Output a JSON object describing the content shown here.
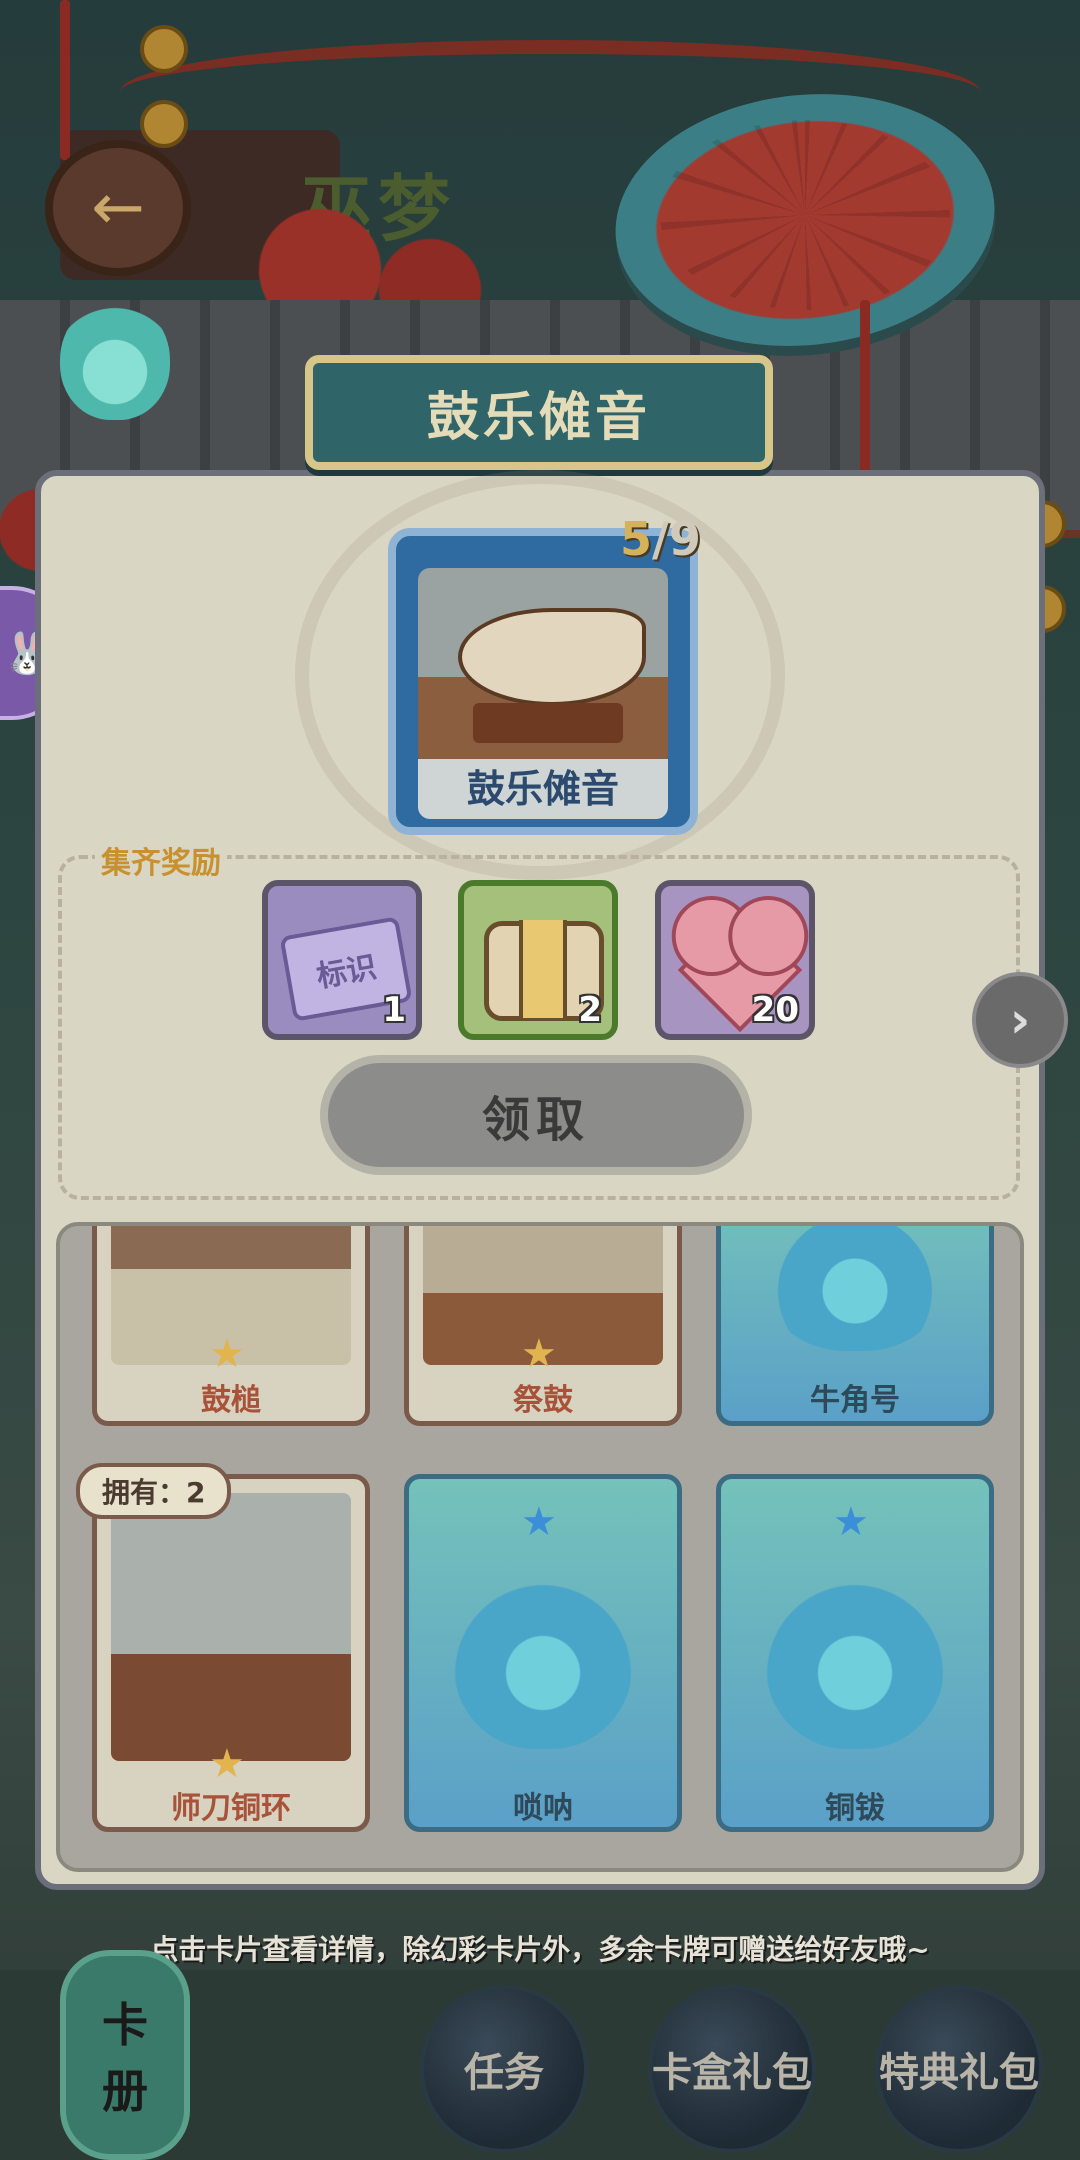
{
  "background": {
    "title_partial": "巫梦"
  },
  "collection": {
    "title": "鼓乐傩音",
    "progress_current": "5",
    "progress_total": "/9",
    "featured_card_label": "鼓乐傩音"
  },
  "rewards": {
    "label": "集齐奖励",
    "items": [
      {
        "icon": "tag-icon",
        "text": "标识",
        "quantity": "1"
      },
      {
        "icon": "chest-icon",
        "quantity": "2"
      },
      {
        "icon": "heart-icon",
        "quantity": "20"
      }
    ],
    "claim_label": "领取"
  },
  "cards": {
    "owned_badge": "拥有：2",
    "items": [
      {
        "name": "鼓槌",
        "state": "owned"
      },
      {
        "name": "祭鼓",
        "state": "owned"
      },
      {
        "name": "牛角号",
        "state": "locked"
      },
      {
        "name": "师刀铜环",
        "state": "owned"
      },
      {
        "name": "唢呐",
        "state": "locked"
      },
      {
        "name": "铜钹",
        "state": "locked"
      }
    ]
  },
  "hint": "点击卡片查看详情，除幻彩卡片外，多余卡牌可赠送给好友哦~",
  "bottom_nav": {
    "album_label_1": "卡",
    "album_label_2": "册",
    "tasks": "任务",
    "card_box": "卡盒礼包",
    "special": "特典礼包"
  },
  "colors": {
    "panel": "#d9d6c4",
    "accent_gold": "#d4b15a",
    "card_owned_text": "#a8523a",
    "card_locked_bg": "#5aa0c8"
  }
}
